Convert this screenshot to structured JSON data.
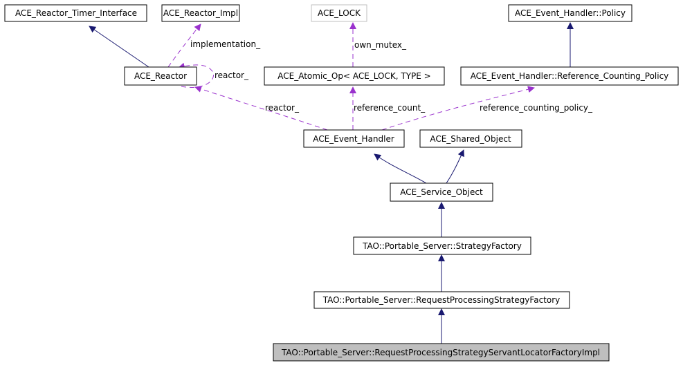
{
  "diagram": {
    "type": "collaboration-graph",
    "colors": {
      "inheritance": "#191970",
      "usage": "#9a32cd",
      "node_border": "#000000",
      "external_node_border": "#bfbfbf",
      "focus_fill": "#bfbfbf",
      "node_fill": "#ffffff"
    },
    "nodes": [
      {
        "id": "timer_iface",
        "label": "ACE_Reactor_Timer_Interface"
      },
      {
        "id": "reactor_impl",
        "label": "ACE_Reactor_Impl"
      },
      {
        "id": "ace_lock",
        "label": "ACE_LOCK",
        "external": true
      },
      {
        "id": "eh_policy",
        "label": "ACE_Event_Handler::Policy"
      },
      {
        "id": "reactor",
        "label": "ACE_Reactor"
      },
      {
        "id": "atomic_op",
        "label": "ACE_Atomic_Op< ACE_LOCK, TYPE >"
      },
      {
        "id": "rc_policy",
        "label": "ACE_Event_Handler::Reference_Counting_Policy"
      },
      {
        "id": "event_handler",
        "label": "ACE_Event_Handler"
      },
      {
        "id": "shared_object",
        "label": "ACE_Shared_Object"
      },
      {
        "id": "service_object",
        "label": "ACE_Service_Object"
      },
      {
        "id": "strategy_factory",
        "label": "TAO::Portable_Server::StrategyFactory"
      },
      {
        "id": "rps_factory",
        "label": "TAO::Portable_Server::RequestProcessingStrategyFactory"
      },
      {
        "id": "rps_sl_factory_impl",
        "label": "TAO::Portable_Server::RequestProcessingStrategyServantLocatorFactoryImpl",
        "focus": true
      }
    ],
    "edges": [
      {
        "from": "reactor",
        "to": "timer_iface",
        "kind": "inheritance"
      },
      {
        "from": "reactor",
        "to": "reactor_impl",
        "kind": "usage",
        "label": "implementation_"
      },
      {
        "from": "reactor",
        "to": "reactor",
        "kind": "usage",
        "label": "reactor_"
      },
      {
        "from": "atomic_op",
        "to": "ace_lock",
        "kind": "usage",
        "label": "own_mutex_"
      },
      {
        "from": "rc_policy",
        "to": "eh_policy",
        "kind": "inheritance"
      },
      {
        "from": "event_handler",
        "to": "reactor",
        "kind": "usage",
        "label": "reactor_"
      },
      {
        "from": "event_handler",
        "to": "atomic_op",
        "kind": "usage",
        "label": "reference_count_"
      },
      {
        "from": "event_handler",
        "to": "rc_policy",
        "kind": "usage",
        "label": "reference_counting_policy_"
      },
      {
        "from": "service_object",
        "to": "event_handler",
        "kind": "inheritance"
      },
      {
        "from": "service_object",
        "to": "shared_object",
        "kind": "inheritance"
      },
      {
        "from": "strategy_factory",
        "to": "service_object",
        "kind": "inheritance"
      },
      {
        "from": "rps_factory",
        "to": "strategy_factory",
        "kind": "inheritance"
      },
      {
        "from": "rps_sl_factory_impl",
        "to": "rps_factory",
        "kind": "inheritance"
      }
    ]
  }
}
